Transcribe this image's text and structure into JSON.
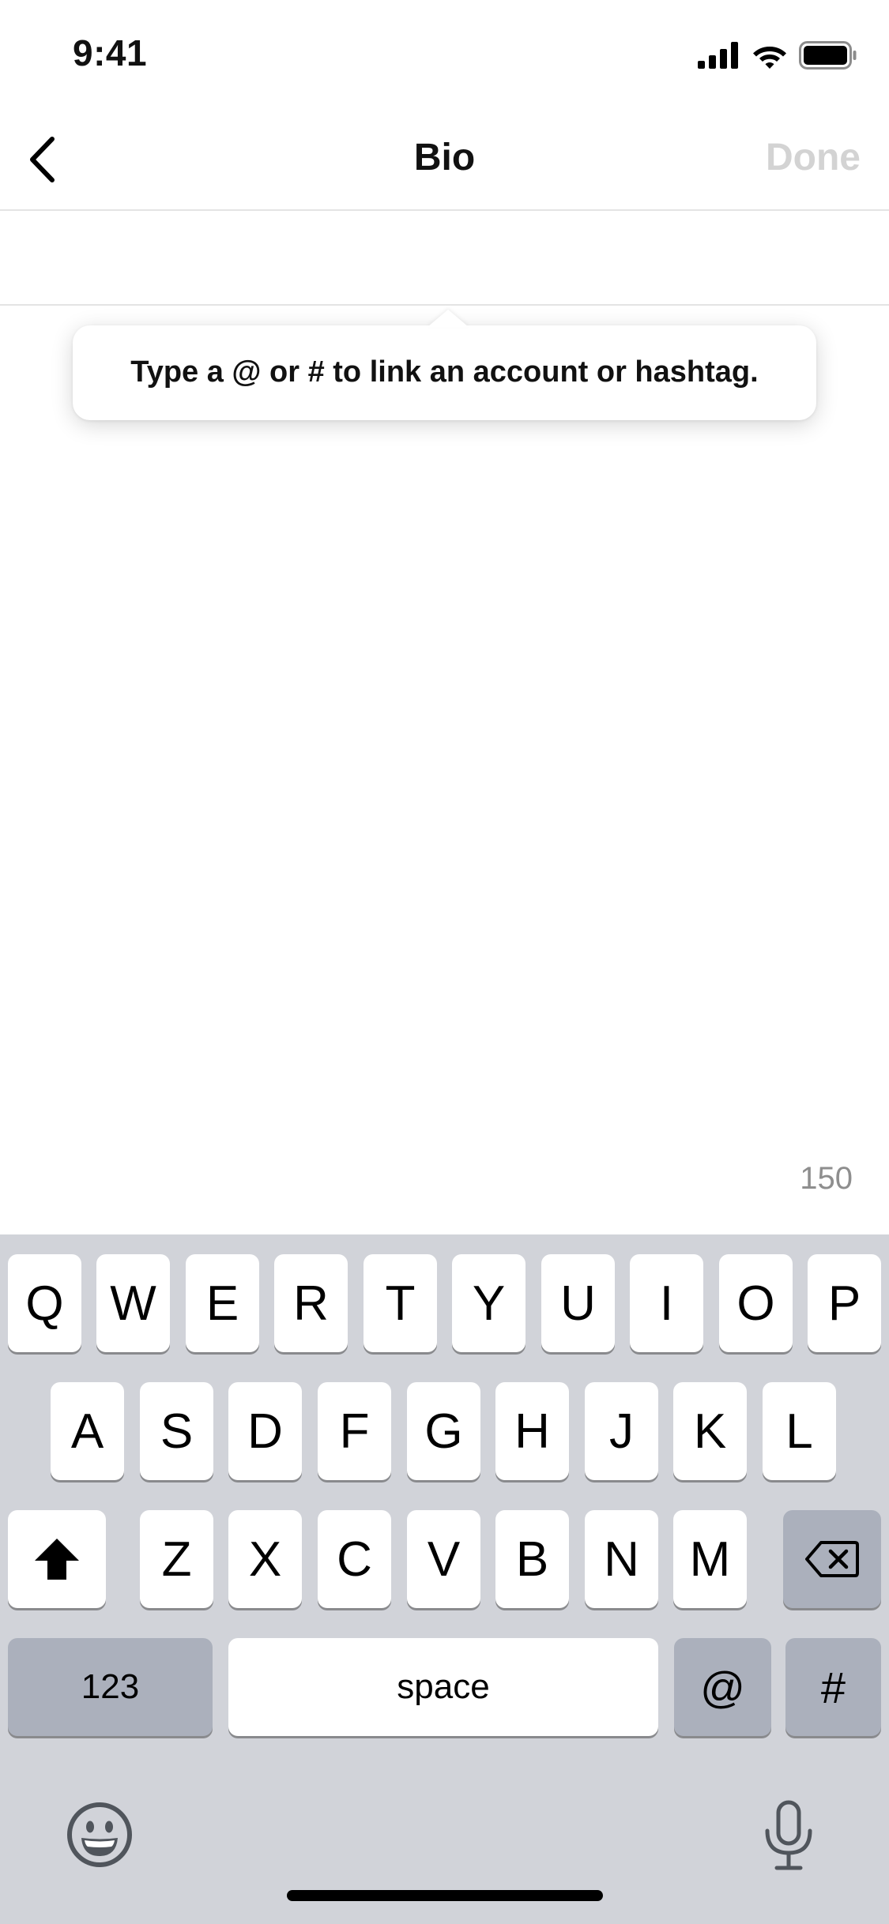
{
  "status_bar": {
    "time": "9:41"
  },
  "nav": {
    "title": "Bio",
    "done_label": "Done"
  },
  "bio": {
    "value": "",
    "placeholder": ""
  },
  "tooltip": {
    "text": "Type a @ or # to link an account or hashtag."
  },
  "char_counter": "150",
  "keyboard": {
    "row1": [
      "Q",
      "W",
      "E",
      "R",
      "T",
      "Y",
      "U",
      "I",
      "O",
      "P"
    ],
    "row2": [
      "A",
      "S",
      "D",
      "F",
      "G",
      "H",
      "J",
      "K",
      "L"
    ],
    "row3": [
      "Z",
      "X",
      "C",
      "V",
      "B",
      "N",
      "M"
    ],
    "numbers_label": "123",
    "space_label": "space",
    "at_label": "@",
    "hash_label": "#"
  },
  "colors": {
    "done_disabled": "#d3d3d3",
    "keyboard_bg": "#d1d3d9",
    "dark_key": "#abb0bc",
    "counter": "#8e8e8e"
  }
}
